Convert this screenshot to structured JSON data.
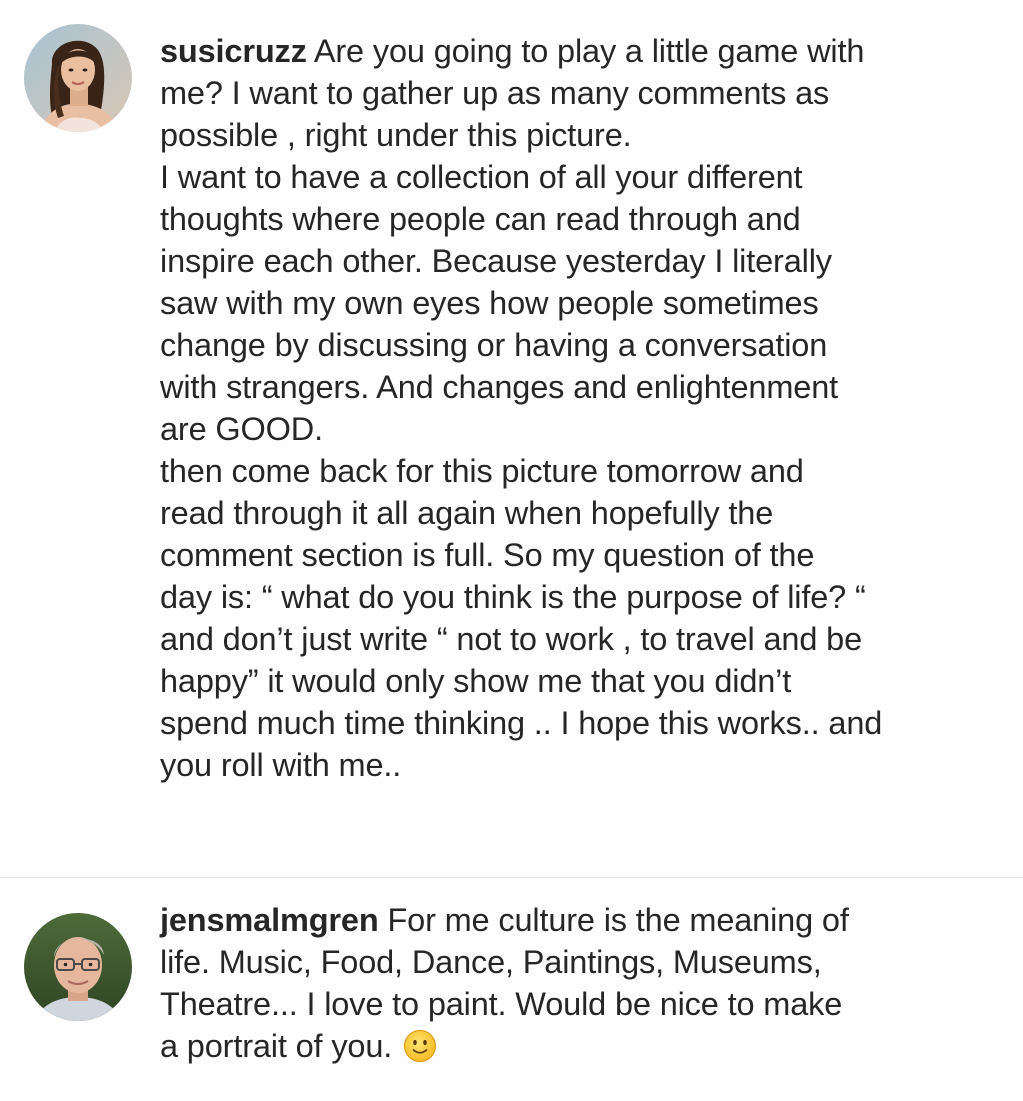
{
  "comments": [
    {
      "username": "susicruzz",
      "avatar_icon": "woman-portrait-avatar",
      "lines": [
        "Are you going to play a little game with",
        "me? I want to gather up as many comments as",
        "possible , right under this picture.",
        "I want to have a collection of all your different",
        "thoughts where people can read through and",
        "inspire each other. Because yesterday I literally",
        "saw with my own eyes how people sometimes",
        "change by discussing or having a conversation",
        "with strangers. And changes and enlightenment",
        "are GOOD.",
        "then come back for this picture tomorrow and",
        "read through it all again when hopefully the",
        "comment section is full. So my question of the",
        "day is: “ what do you think is the purpose of life? “",
        "and don’t just write “ not to work , to travel and be",
        "happy” it would only show me that you didn’t",
        "spend much time thinking .. I hope this works.. and",
        "you roll with me.."
      ]
    },
    {
      "username": "jensmalmgren",
      "avatar_icon": "man-glasses-portrait-avatar",
      "lines": [
        "For me culture is the meaning of",
        "life. Music, Food, Dance, Paintings, Museums,",
        "Theatre... I love to paint. Would be nice to make",
        "a portrait of you."
      ],
      "trailing_icon": "slightly-smiling-face-emoji"
    }
  ],
  "colors": {
    "text": "#262626",
    "divider": "#e3e3e3",
    "background": "#ffffff"
  }
}
